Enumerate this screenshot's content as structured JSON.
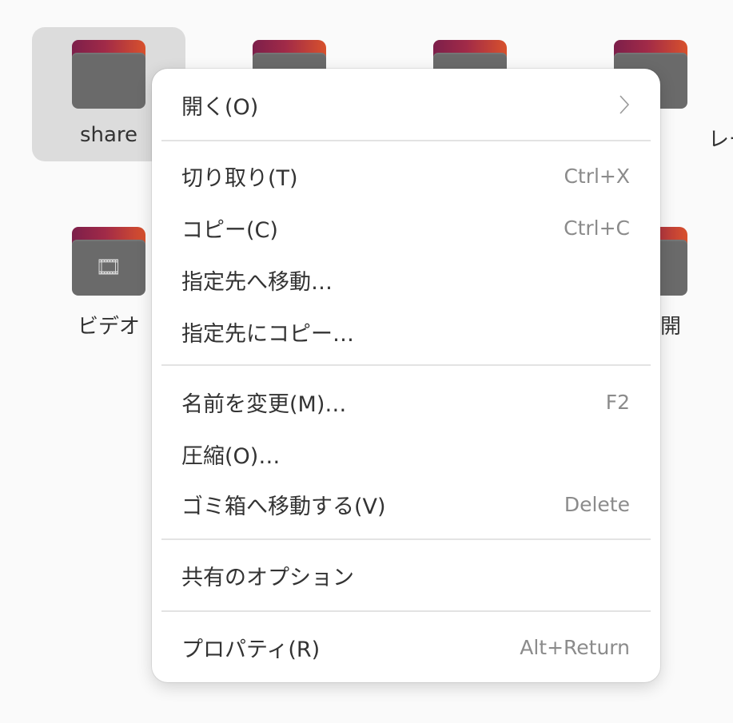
{
  "colors": {
    "desktop_background": "#fafafa",
    "selection": "#dcdcdc",
    "folder_front": "#6a6a6a",
    "folder_tab_gradient": [
      "#7c1f4a",
      "#a12a48",
      "#d8512c"
    ],
    "menu_background": "#ffffff",
    "menu_text": "#333333",
    "shortcut_text": "#8b8b8b"
  },
  "folders": [
    {
      "label": "share",
      "icon": "folder-icon",
      "selected": true
    },
    {
      "label": "",
      "icon": "folder-icon",
      "selected": false
    },
    {
      "label": "",
      "icon": "folder-icon",
      "selected": false
    },
    {
      "label": "レー",
      "icon": "folder-icon",
      "selected": false
    },
    {
      "label": "ビデオ",
      "icon": "video-folder-icon",
      "selected": false
    },
    {
      "label": "開",
      "icon": "folder-icon",
      "selected": false
    }
  ],
  "context_menu": {
    "items": [
      {
        "label": "開く(O)",
        "shortcut": "",
        "submenu_icon": "chevron-right-icon"
      },
      {
        "label": "切り取り(T)",
        "shortcut": "Ctrl+X"
      },
      {
        "label": "コピー(C)",
        "shortcut": "Ctrl+C"
      },
      {
        "label": "指定先へ移動…",
        "shortcut": ""
      },
      {
        "label": "指定先にコピー…",
        "shortcut": ""
      },
      {
        "label": "名前を変更(M)…",
        "shortcut": "F2"
      },
      {
        "label": "圧縮(O)…",
        "shortcut": ""
      },
      {
        "label": "ゴミ箱へ移動する(V)",
        "shortcut": "Delete"
      },
      {
        "label": "共有のオプション",
        "shortcut": ""
      },
      {
        "label": "プロパティ(R)",
        "shortcut": "Alt+Return"
      }
    ]
  }
}
